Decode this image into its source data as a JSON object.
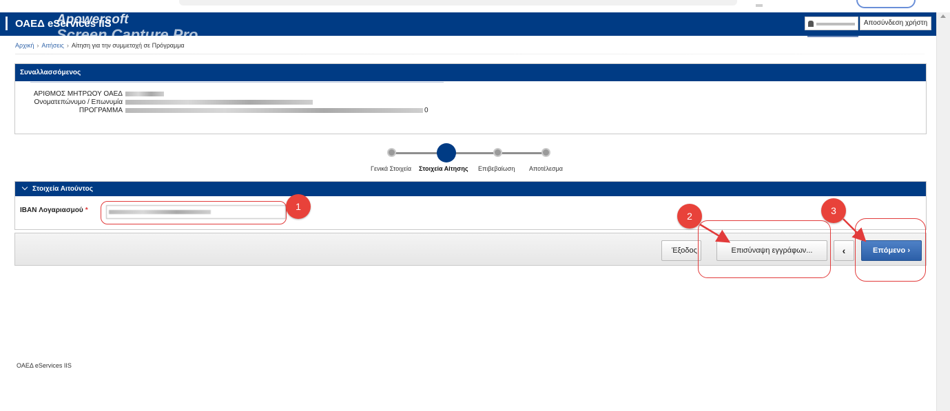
{
  "header": {
    "brand": "ΟΑΕΔ eServices IIS",
    "watermark_line1": "Apowersoft",
    "watermark_line2": "Screen Capture Pro",
    "logout_label": "Αποσύνδεση χρήστη"
  },
  "breadcrumb": {
    "items": [
      "Αρχική",
      "Αιτήσεις",
      "Αίτηση για την συμμετοχή σε Πρόγραμμα"
    ]
  },
  "participant_panel": {
    "title": "Συναλλασσόμενος",
    "rows": [
      {
        "label": "ΑΡΙΘΜΟΣ ΜΗΤΡΩΟΥ ΟΑΕΔ",
        "tail": ""
      },
      {
        "label": "Ονοματεπώνυμο / Επωνυμία",
        "tail": ""
      },
      {
        "label": "ΠΡΟΓΡΑΜΜΑ",
        "tail": "0"
      }
    ]
  },
  "stepper": {
    "steps": [
      "Γενικά Στοιχεία",
      "Στοιχεία Αίτησης",
      "Επιβεβαίωση",
      "Αποτέλεσμα"
    ],
    "active_index": 1
  },
  "applicant_panel": {
    "title": "Στοιχεία Αιτούντος",
    "iban_label": "IBAN Λογαριασμού",
    "required_mark": "*"
  },
  "toolbar": {
    "exit_label": "Έξοδος",
    "attach_label": "Επισύναψη εγγράφων...",
    "prev_label": "‹",
    "next_label": "Επόμενο ›"
  },
  "annotations": [
    "1",
    "2",
    "3"
  ],
  "footer": {
    "text": "ΟΑΕΔ eServices IIS"
  },
  "colors": {
    "header": "#003b84",
    "annotation": "#e8423a",
    "primary_button": "#2c5fa8"
  }
}
